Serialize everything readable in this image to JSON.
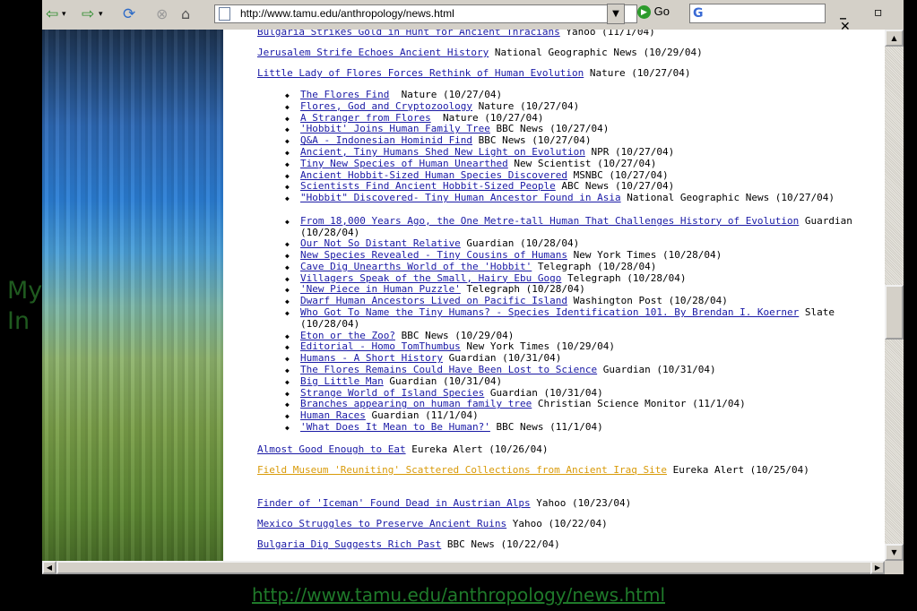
{
  "slide": {
    "side_text": "My\nIn",
    "bottom_url": "http://www.tamu.edu/anthropology/news.html"
  },
  "browser": {
    "address": "http://www.tamu.edu/anthropology/news.html",
    "go_label": "Go",
    "window_controls": "_ ▫ ✕",
    "icons": [
      "back-arrow-icon",
      "forward-arrow-icon",
      "refresh-icon",
      "stop-icon",
      "home-icon",
      "page-icon",
      "google-icon"
    ]
  },
  "content": {
    "top_items": [
      {
        "link": "Bulgaria Strikes Gold in Hunt for Ancient Thracians",
        "source": " Yahoo (11/1/04)"
      },
      {
        "link": "Jerusalem Strife Echoes Ancient History",
        "source": " National Geographic News (10/29/04)"
      },
      {
        "link": "Little Lady of Flores Forces Rethink of Human Evolution",
        "source": " Nature (10/27/04)"
      }
    ],
    "sub_items": [
      {
        "link": "The Flores Find",
        "source": "  Nature (10/27/04)"
      },
      {
        "link": "Flores, God and Cryptozoology",
        "source": " Nature (10/27/04)"
      },
      {
        "link": "A Stranger from Flores",
        "source": "  Nature (10/27/04)"
      },
      {
        "link": "'Hobbit' Joins Human Family Tree",
        "source": " BBC News (10/27/04)"
      },
      {
        "link": "Q&A - Indonesian Hominid Find",
        "source": " BBC News (10/27/04)"
      },
      {
        "link": "Ancient, Tiny Humans Shed New Light on Evolution",
        "source": " NPR (10/27/04)"
      },
      {
        "link": "Tiny New Species of Human Unearthed",
        "source": " New Scientist (10/27/04)"
      },
      {
        "link": "Ancient Hobbit-Sized Human Species Discovered",
        "source": " MSNBC (10/27/04)"
      },
      {
        "link": "Scientists Find Ancient Hobbit-Sized People",
        "source": " ABC News (10/27/04)"
      },
      {
        "link": "\"Hobbit\" Discovered- Tiny Human Ancestor Found in Asia",
        "source": " National Geographic News (10/27/04)"
      },
      {
        "link": "From 18,000 Years Ago, the One Metre-tall Human That Challenges History of Evolution",
        "source": " Guardian (10/28/04)"
      },
      {
        "link": "Our Not So Distant Relative",
        "source": " Guardian (10/28/04)"
      },
      {
        "link": "New Species Revealed - Tiny Cousins of Humans",
        "source": " New York Times (10/28/04)"
      },
      {
        "link": "Cave Dig Unearths World of the 'Hobbit'",
        "source": " Telegraph (10/28/04)"
      },
      {
        "link": "Villagers Speak of the Small, Hairy Ebu Gogo",
        "source": " Telegraph (10/28/04)"
      },
      {
        "link": "'New Piece in Human Puzzle'",
        "source": " Telegraph (10/28/04)"
      },
      {
        "link": "Dwarf Human Ancestors Lived on Pacific Island",
        "source": " Washington Post (10/28/04)"
      },
      {
        "link": "Who Got To Name the Tiny Humans? - Species Identification 101. By Brendan I. Koerner",
        "source": " Slate (10/28/04)"
      },
      {
        "link": "Eton or the Zoo?",
        "source": " BBC News (10/29/04)"
      },
      {
        "link": "Editorial - Homo TomThumbus",
        "source": " New York Times (10/29/04)"
      },
      {
        "link": "Humans - A Short History",
        "source": " Guardian (10/31/04)"
      },
      {
        "link": "The Flores Remains Could Have Been Lost to Science",
        "source": " Guardian (10/31/04)"
      },
      {
        "link": "Big Little Man",
        "source": " Guardian (10/31/04)"
      },
      {
        "link": "Strange World of Island Species",
        "source": " Guardian (10/31/04)"
      },
      {
        "link": "Branches appearing on human family tree",
        "source": " Christian Science Monitor (11/1/04)"
      },
      {
        "link": "Human Races",
        "source": " Guardian (11/1/04)"
      },
      {
        "link": "'What Does It Mean to Be Human?'",
        "source": " BBC News (11/1/04)"
      }
    ],
    "bottom_items": [
      {
        "link": "Almost Good Enough to Eat",
        "source": " Eureka Alert (10/26/04)",
        "visited": false
      },
      {
        "link": "Field Museum 'Reuniting' Scattered Collections from Ancient Iraq Site",
        "source": " Eureka Alert (10/25/04)",
        "visited": true
      },
      {
        "link": "Finder of 'Iceman' Found Dead in Austrian Alps",
        "source": " Yahoo (10/23/04)",
        "visited": false
      },
      {
        "link": "Mexico Struggles to Preserve Ancient Ruins",
        "source": " Yahoo (10/22/04)",
        "visited": false
      },
      {
        "link": "Bulgaria Dig Suggests Rich Past",
        "source": " BBC News (10/22/04)",
        "visited": false
      }
    ]
  },
  "colors": {
    "link": "#1a1aa6",
    "visited": "#d99b0a",
    "slide_text": "#1f7a2a"
  }
}
